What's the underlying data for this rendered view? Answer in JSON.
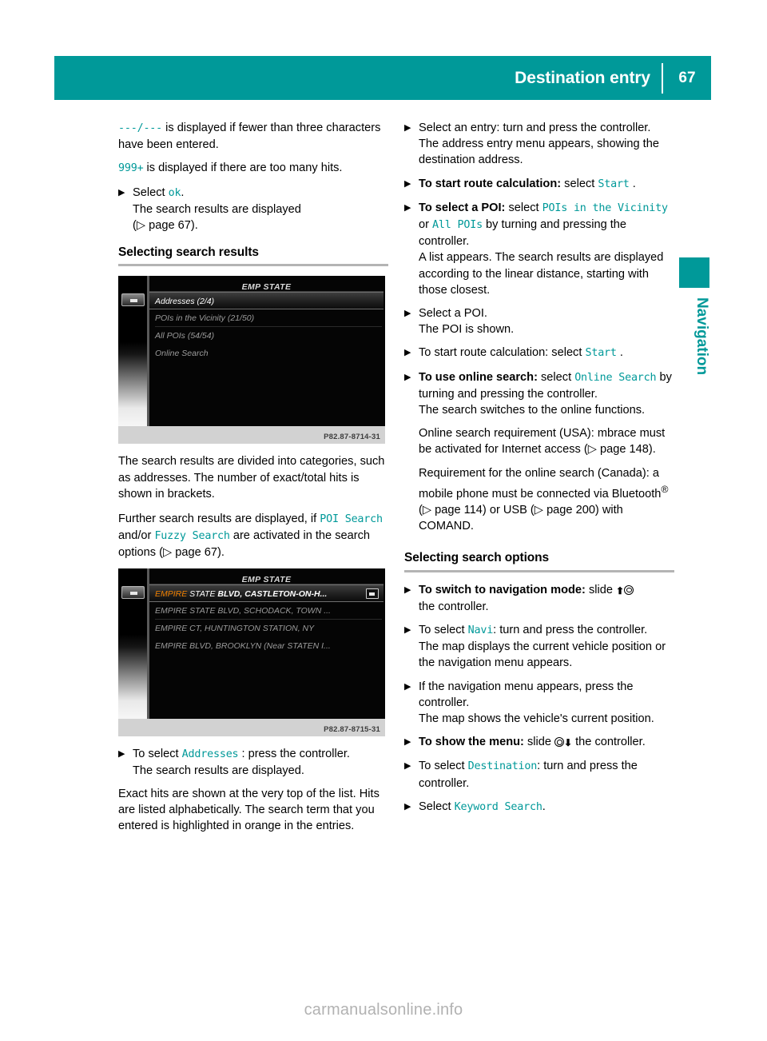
{
  "header": {
    "title": "Destination entry",
    "page_number": "67"
  },
  "side_tab": {
    "label": "Navigation"
  },
  "watermark": "carmanualsonline.info",
  "left_column": {
    "intro_dashes_code": "---/---",
    "intro_dashes_rest": " is displayed if fewer than three characters have been entered.",
    "intro_999_code": "999+",
    "intro_999_rest": " is displayed if there are too many hits.",
    "step_select_ok_pre": "Select ",
    "step_select_ok_code": "ok",
    "step_select_ok_post": ".",
    "step_select_ok_cont": "The search results are displayed",
    "step_select_ok_ref": "(▷ page 67).",
    "heading_results": "Selecting search results",
    "shot1": {
      "title": "EMP STATE",
      "rows": [
        "Addresses (2/4)",
        "POIs in the Vicinity (21/50)",
        "All POIs (54/54)",
        "Online Search"
      ],
      "selected_index": 0,
      "caption": "P82.87-8714-31"
    },
    "para_categories": "The search results are divided into categories, such as addresses. The number of exact/total hits is shown in brackets.",
    "para_further_1": "Further search results are displayed, if ",
    "para_further_code1": "POI Search",
    "para_further_2": " and/or ",
    "para_further_code2": "Fuzzy Search",
    "para_further_3": " are activated in the search options (▷ page 67).",
    "shot2": {
      "title": "EMP STATE",
      "rows": [
        {
          "highlight": "EMPIRE",
          "normal": " STATE ",
          "bold": "BLVD, CASTLETON-ON-H...",
          "badge": true
        },
        {
          "text": "EMPIRE STATE BLVD, SCHODACK, TOWN ..."
        },
        {
          "text": "EMPIRE CT, HUNTINGTON STATION, NY"
        },
        {
          "text": "EMPIRE BLVD, BROOKLYN (Near STATEN I..."
        }
      ],
      "caption": "P82.87-8715-31"
    },
    "step_addresses_pre": "To select ",
    "step_addresses_code": "Addresses",
    "step_addresses_post": " : press the controller.",
    "step_addresses_cont": "The search results are displayed.",
    "para_exact_hits": "Exact hits are shown at the very top of the list. Hits are listed alphabetically. The search term that you entered is highlighted in orange in the entries."
  },
  "right_column": {
    "step_select_entry": "Select an entry: turn and press the controller.",
    "step_select_entry_cont1": "The address entry menu appears, showing the destination address.",
    "step_route_bold": "To start route calculation:",
    "step_route_rest": " select ",
    "step_route_code": "Start",
    "step_route_post": " .",
    "step_poi_bold": "To select a POI:",
    "step_poi_rest": " select ",
    "step_poi_code1": "POIs in the Vicinity",
    "step_poi_or": " or ",
    "step_poi_code2": "All POIs",
    "step_poi_post": " by turning and pressing the controller.",
    "step_poi_cont": "A list appears. The search results are displayed according to the linear distance, starting with those closest.",
    "step_select_poi": "Select a POI.",
    "step_select_poi_cont": "The POI is shown.",
    "step_route2_pre": "To start route calculation: select ",
    "step_route2_code": "Start",
    "step_route2_post": " .",
    "step_online_bold": "To use online search:",
    "step_online_rest": " select ",
    "step_online_code": "Online Search",
    "step_online_post": " by turning and pressing the controller.",
    "step_online_cont1": "The search switches to the online functions.",
    "step_online_cont2": "Online search requirement (USA): mbrace must be activated for Internet access (▷ page 148).",
    "step_online_cont3_a": "Requirement for the online search (Canada): a mobile phone must be connected via Bluetooth",
    "step_online_cont3_sup": "®",
    "step_online_cont3_b": " (▷ page 114) or USB (▷ page 200) with COMAND.",
    "heading_options": "Selecting search options",
    "step_nav_bold": "To switch to navigation mode:",
    "step_nav_rest": " slide ",
    "step_nav_post": "",
    "step_nav_cont": "the controller.",
    "step_navi_pre": "To select ",
    "step_navi_code": "Navi",
    "step_navi_post": ": turn and press the controller.",
    "step_navi_cont": "The map displays the current vehicle position or the navigation menu appears.",
    "step_ifmenu": "If the navigation menu appears, press the controller.",
    "step_ifmenu_cont": "The map shows the vehicle's current position.",
    "step_showmenu_bold": "To show the menu:",
    "step_showmenu_rest": " slide ",
    "step_showmenu_post": " the controller.",
    "step_dest_pre": "To select ",
    "step_dest_code": "Destination",
    "step_dest_post": ": turn and press the controller.",
    "step_keyword_pre": "Select ",
    "step_keyword_code": "Keyword Search",
    "step_keyword_post": "."
  }
}
